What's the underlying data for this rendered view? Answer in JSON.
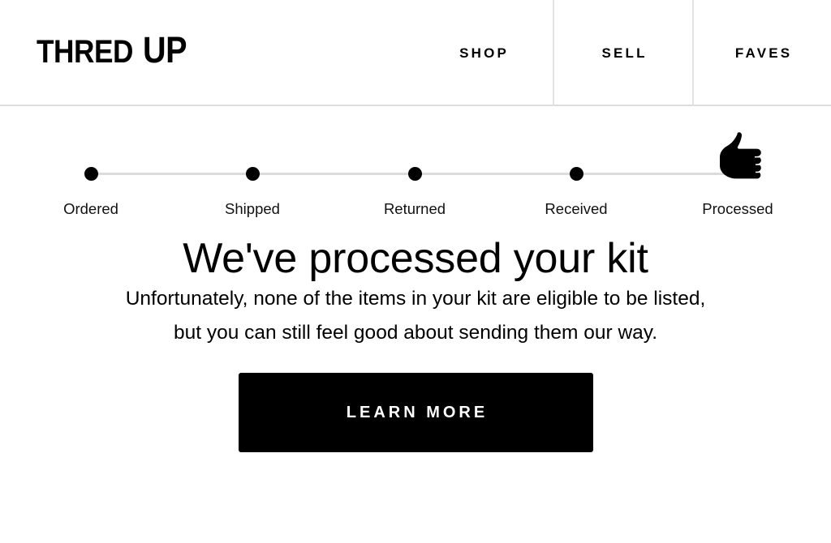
{
  "header": {
    "logo": {
      "part1": "THRED",
      "part2": "UP",
      "full": "THREDUP"
    },
    "nav": [
      {
        "label": "SHOP",
        "name": "shop"
      },
      {
        "label": "SELL",
        "name": "sell"
      },
      {
        "label": "FAVES",
        "name": "faves"
      }
    ]
  },
  "progress": {
    "steps": [
      {
        "label": "Ordered",
        "marker": "dot",
        "complete": true
      },
      {
        "label": "Shipped",
        "marker": "dot",
        "complete": true
      },
      {
        "label": "Returned",
        "marker": "dot",
        "complete": true
      },
      {
        "label": "Received",
        "marker": "dot",
        "complete": true
      },
      {
        "label": "Processed",
        "marker": "thumbs-up-icon",
        "complete": true
      }
    ],
    "current_step": "Processed",
    "line_color": "#dcdcdc",
    "dot_color": "#000000"
  },
  "hero": {
    "title": "We've processed your kit",
    "body_line_1": "Unfortunately, none of the items in your kit are eligible to be listed,",
    "body_line_2": "but you can still feel good about sending them our way.",
    "cta_label": "LEARN MORE"
  },
  "colors": {
    "background": "#ffffff",
    "text": "#000000",
    "button_bg": "#000000",
    "button_text": "#ffffff",
    "border": "#dddddd",
    "muted_line": "#dcdcdc"
  }
}
